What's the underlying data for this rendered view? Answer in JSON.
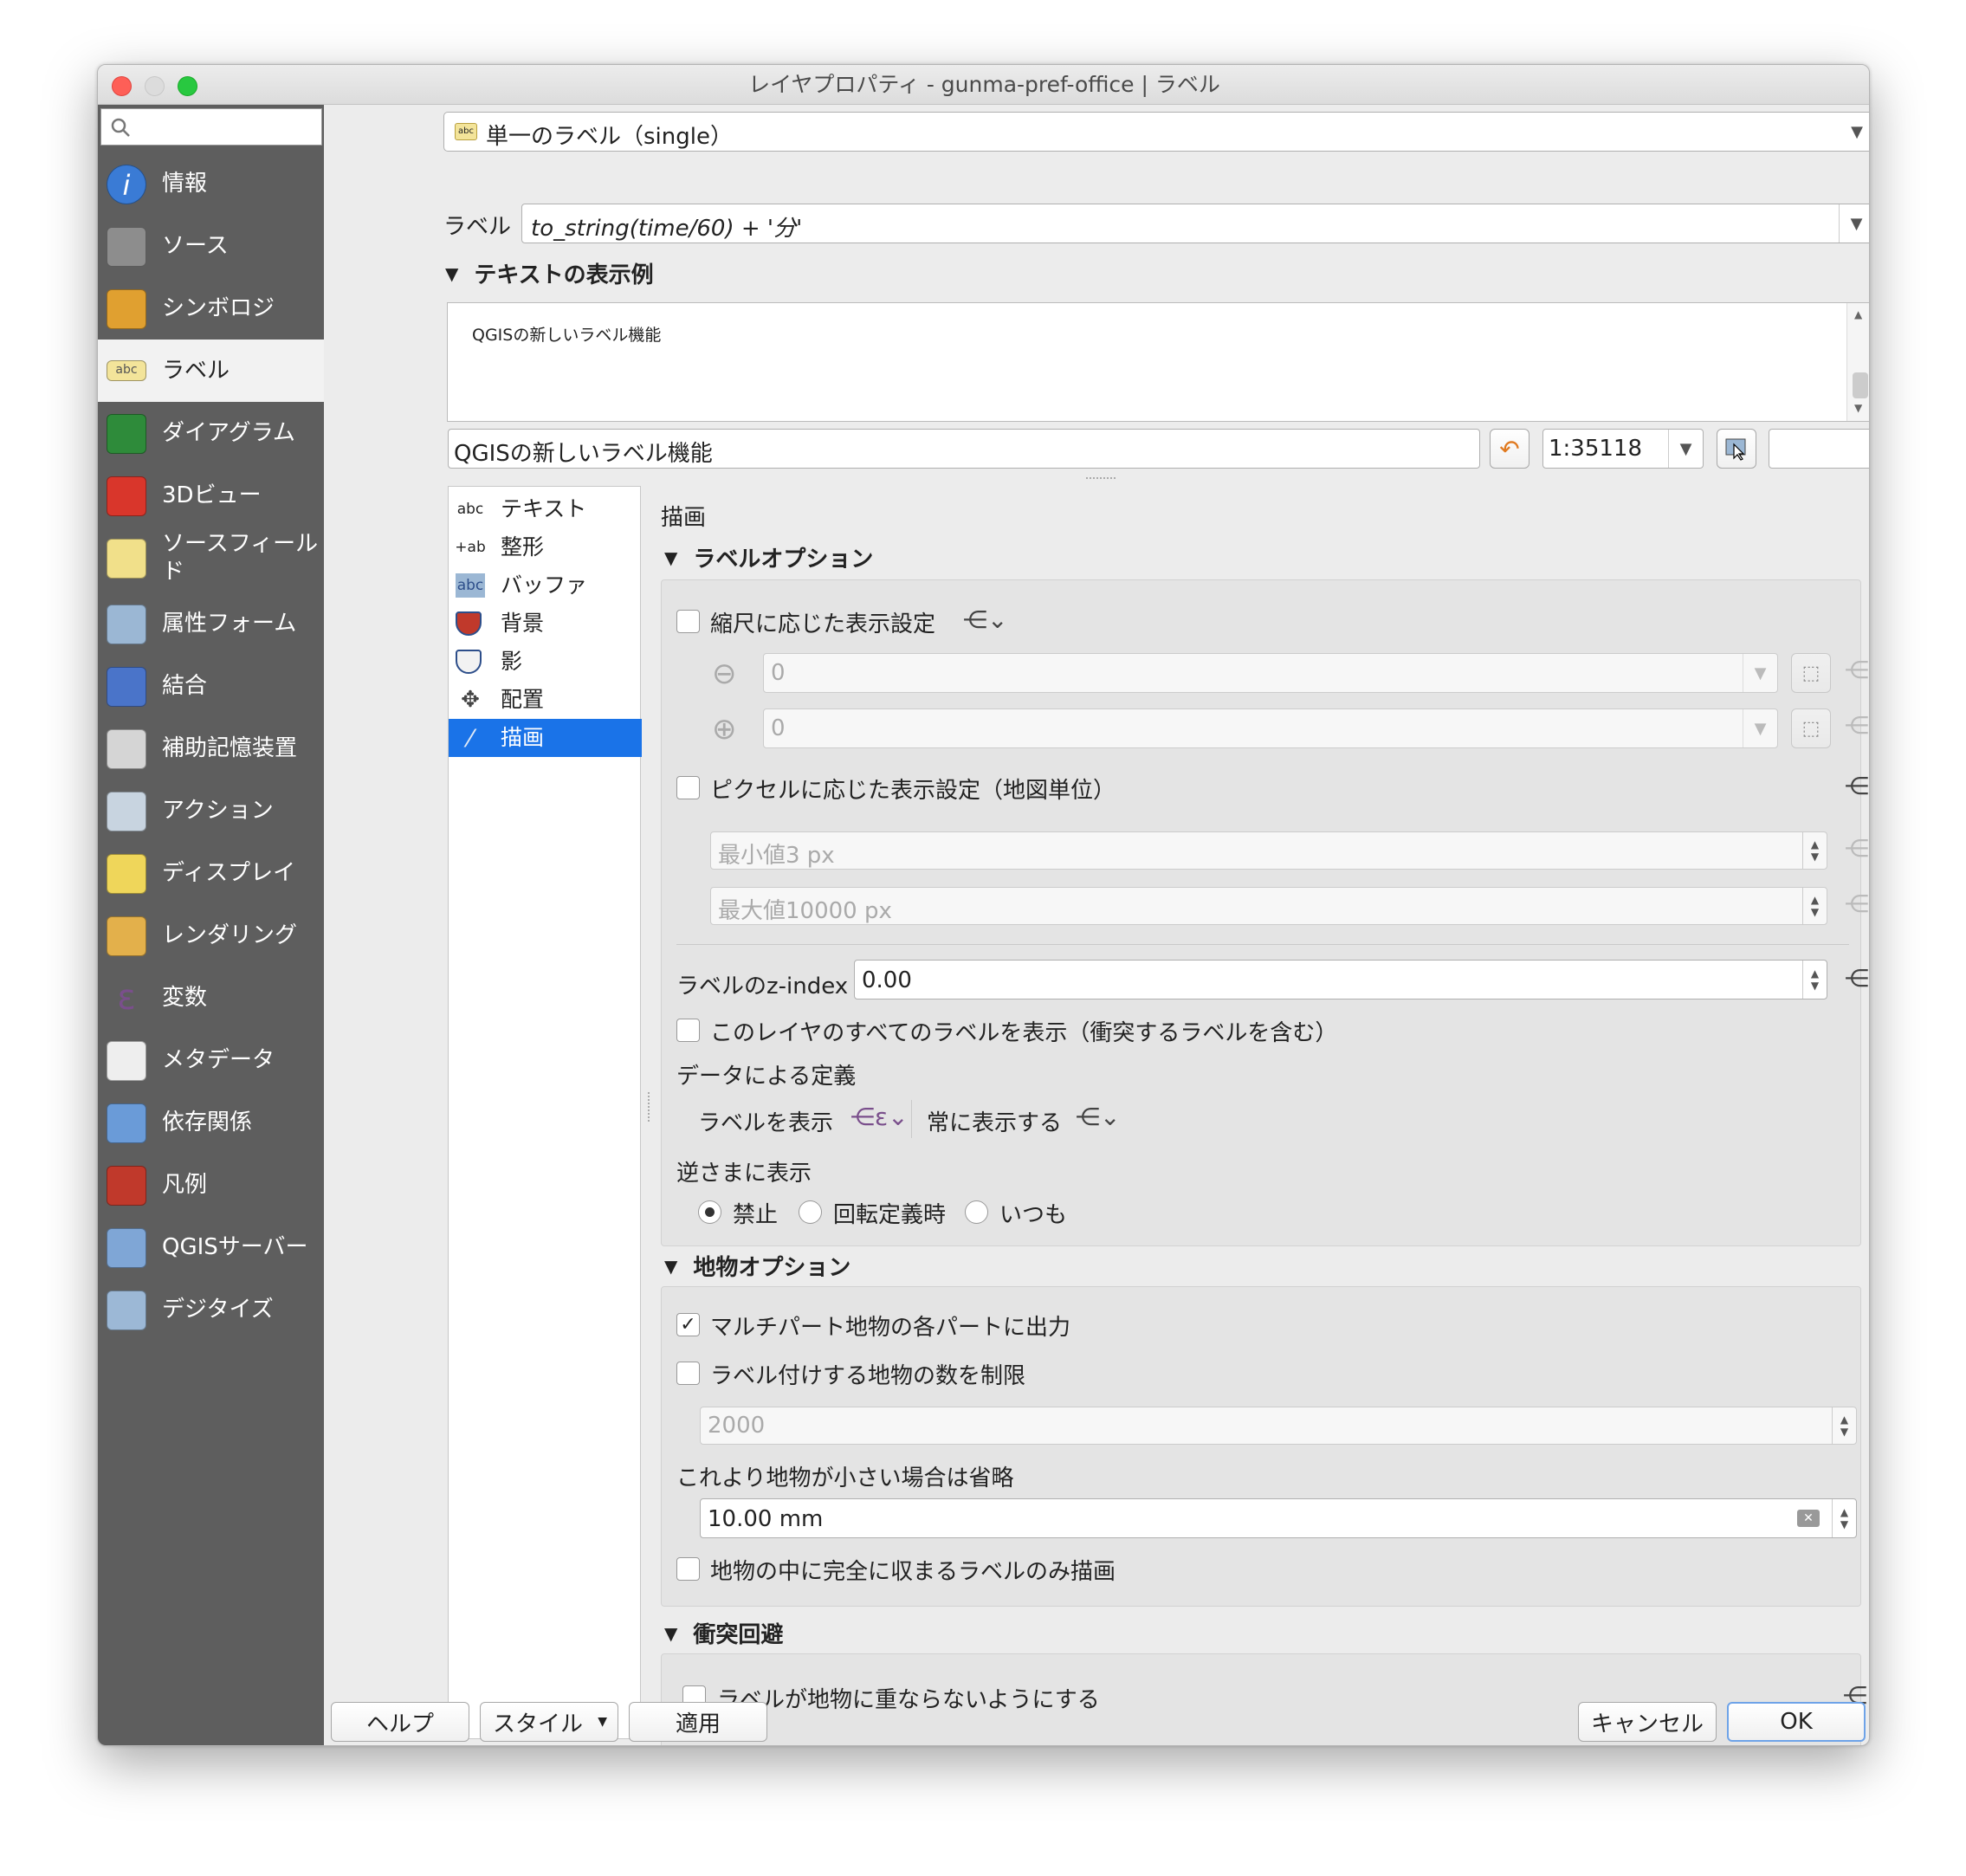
{
  "window": {
    "title": "レイヤプロパティ - gunma-pref-office | ラベル"
  },
  "sidebar": {
    "search_placeholder": "",
    "items": [
      {
        "label": "情報",
        "icon": "info-icon",
        "color": "#3a7bd5"
      },
      {
        "label": "ソース",
        "icon": "tools-icon",
        "color": "#8d8d8d"
      },
      {
        "label": "シンボロジ",
        "icon": "paint-brush-icon",
        "color": "#e0a030"
      },
      {
        "label": "ラベル",
        "icon": "abc-label-icon",
        "color": "#f3e49a"
      },
      {
        "label": "ダイアグラム",
        "icon": "diagram-icon",
        "color": "#2e8b3a"
      },
      {
        "label": "3Dビュー",
        "icon": "cube-3d-icon",
        "color": "#d9362b"
      },
      {
        "label": "ソースフィールド",
        "icon": "fields-icon",
        "color": "#f1e08a"
      },
      {
        "label": "属性フォーム",
        "icon": "form-icon",
        "color": "#9bb7d4"
      },
      {
        "label": "結合",
        "icon": "join-icon",
        "color": "#4a74c9"
      },
      {
        "label": "補助記憶装置",
        "icon": "database-icon",
        "color": "#d5d5d5"
      },
      {
        "label": "アクション",
        "icon": "action-gear-icon",
        "color": "#c8d4e0"
      },
      {
        "label": "ディスプレイ",
        "icon": "speech-bubble-icon",
        "color": "#efd65a"
      },
      {
        "label": "レンダリング",
        "icon": "render-brush-icon",
        "color": "#e3b04b"
      },
      {
        "label": "変数",
        "icon": "epsilon-icon",
        "color": "#7a4f8c"
      },
      {
        "label": "メタデータ",
        "icon": "metadata-icon",
        "color": "#eeeeee"
      },
      {
        "label": "依存関係",
        "icon": "dependencies-icon",
        "color": "#6a9bd8"
      },
      {
        "label": "凡例",
        "icon": "legend-icon",
        "color": "#c0392b"
      },
      {
        "label": "QGISサーバー",
        "icon": "qgis-server-icon",
        "color": "#7fa6d6"
      },
      {
        "label": "デジタイズ",
        "icon": "digitize-icon",
        "color": "#9cb8d6"
      }
    ]
  },
  "label_mode": {
    "value": "単一のラベル（single）"
  },
  "label_row": {
    "label": "ラベル",
    "expression": "to_string(time/60) + '分'"
  },
  "preview": {
    "section_title": "テキストの表示例",
    "sample_text": "QGISの新しいラベル機能",
    "input_text": "QGISの新しいラベル機能",
    "scale": "1:35118"
  },
  "tabs": {
    "items": [
      {
        "label": "テキスト",
        "icon": "abc"
      },
      {
        "label": "整形",
        "icon": "+ab"
      },
      {
        "label": "バッファ",
        "icon": "abc"
      },
      {
        "label": "背景",
        "icon": ""
      },
      {
        "label": "影",
        "icon": ""
      },
      {
        "label": "配置",
        "icon": ""
      },
      {
        "label": "描画",
        "icon": ""
      }
    ]
  },
  "render": {
    "heading": "描画",
    "label_options": {
      "title": "ラベルオプション",
      "scale_based": "縮尺に応じた表示設定",
      "min_scale": "0",
      "max_scale": "0",
      "pixel_based": "ピクセルに応じた表示設定（地図単位）",
      "min_px_placeholder": "最小値3 px",
      "max_px_placeholder": "最大値10000 px",
      "zindex_label": "ラベルのz-index",
      "zindex_value": "0.00",
      "show_all": "このレイヤのすべてのラベルを表示（衝突するラベルを含む）",
      "data_defined": "データによる定義",
      "show_label": "ラベルを表示",
      "always_show": "常に表示する",
      "upside_down": "逆さまに表示",
      "opt_never": "禁止",
      "opt_rotation": "回転定義時",
      "opt_always": "いつも"
    },
    "feature_options": {
      "title": "地物オプション",
      "multipart": "マルチパート地物の各パートに出力",
      "limit": "ラベル付けする地物の数を制限",
      "limit_placeholder": "2000",
      "suppress": "これより地物が小さい場合は省略",
      "suppress_value": "10.00 mm",
      "inside_only": "地物の中に完全に収まるラベルのみ描画"
    },
    "obstacles": {
      "title": "衝突回避",
      "discourage": "ラベルが地物に重ならないようにする"
    }
  },
  "buttons": {
    "help": "ヘルプ",
    "style": "スタイル",
    "apply": "適用",
    "cancel": "キャンセル",
    "ok": "OK"
  }
}
